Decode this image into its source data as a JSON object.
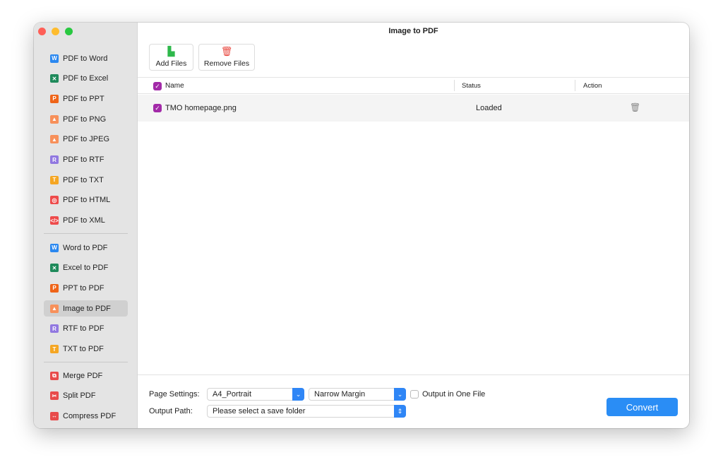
{
  "window": {
    "title": "Image to PDF"
  },
  "sidebar": {
    "groups": [
      [
        {
          "label": "PDF to Word",
          "icon": "W",
          "color": "#2b88f0"
        },
        {
          "label": "PDF to Excel",
          "icon": "✕",
          "color": "#1f8a5b"
        },
        {
          "label": "PDF to PPT",
          "icon": "P",
          "color": "#ef6418"
        },
        {
          "label": "PDF to PNG",
          "icon": "▲",
          "color": "#f7905a"
        },
        {
          "label": "PDF to JPEG",
          "icon": "▲",
          "color": "#f7905a"
        },
        {
          "label": "PDF to RTF",
          "icon": "R",
          "color": "#9178e0"
        },
        {
          "label": "PDF to TXT",
          "icon": "T",
          "color": "#f5a623"
        },
        {
          "label": "PDF to HTML",
          "icon": "◎",
          "color": "#ee4b4b"
        },
        {
          "label": "PDF to XML",
          "icon": "</>",
          "color": "#ee4b4b"
        }
      ],
      [
        {
          "label": "Word to PDF",
          "icon": "W",
          "color": "#2b88f0"
        },
        {
          "label": "Excel to PDF",
          "icon": "✕",
          "color": "#1f8a5b"
        },
        {
          "label": "PPT to PDF",
          "icon": "P",
          "color": "#ef6418"
        },
        {
          "label": "Image to PDF",
          "icon": "▲",
          "color": "#f7905a",
          "active": true
        },
        {
          "label": "RTF to PDF",
          "icon": "R",
          "color": "#9178e0"
        },
        {
          "label": "TXT to PDF",
          "icon": "T",
          "color": "#f5a623"
        }
      ],
      [
        {
          "label": "Merge PDF",
          "icon": "⧉",
          "color": "#e84b4b"
        },
        {
          "label": "Split PDF",
          "icon": "✂",
          "color": "#e84b4b"
        },
        {
          "label": "Compress PDF",
          "icon": "↔",
          "color": "#e84b4b"
        }
      ]
    ]
  },
  "toolbar": {
    "add": "Add Files",
    "remove": "Remove Files"
  },
  "table": {
    "headers": {
      "name": "Name",
      "status": "Status",
      "action": "Action"
    },
    "rows": [
      {
        "name": "TMO homepage.png",
        "status": "Loaded"
      }
    ]
  },
  "settings": {
    "page_label": "Page Settings:",
    "page_size": "A4_Portrait",
    "margin": "Narrow Margin",
    "one_file": "Output in One File",
    "one_file_checked": false,
    "path_label": "Output Path:",
    "path_value": "Please select a save folder",
    "convert": "Convert"
  }
}
